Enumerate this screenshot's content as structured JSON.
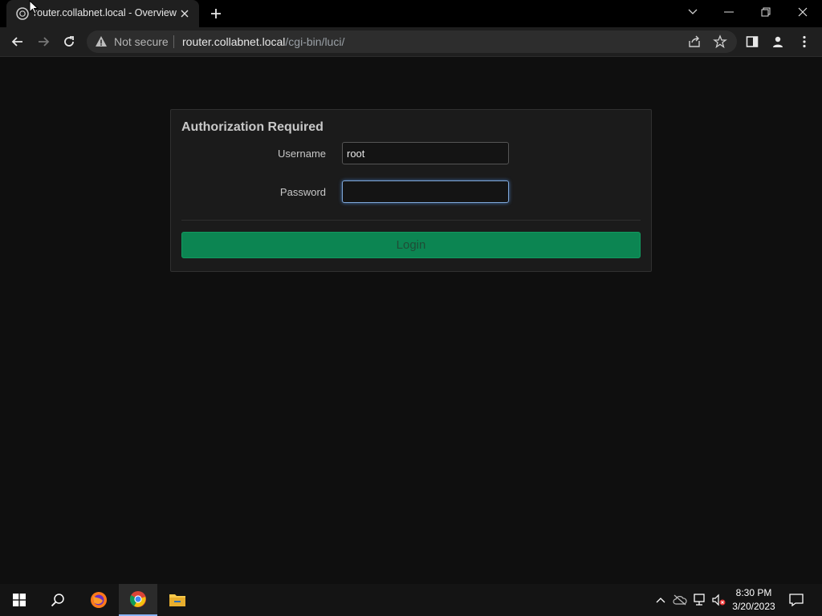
{
  "browser": {
    "tab": {
      "title": "router.collabnet.local - Overview",
      "favicon": "openwrt-icon"
    },
    "new_tab_icon": "plus-icon",
    "window_controls": [
      "chevron-down-icon",
      "minimize-icon",
      "restore-icon",
      "close-icon"
    ],
    "toolbar": {
      "security_label": "Not secure",
      "url_host": "router.collabnet.local",
      "url_path": "/cgi-bin/luci/"
    }
  },
  "login": {
    "title": "Authorization Required",
    "username_label": "Username",
    "username_value": "root",
    "password_label": "Password",
    "password_value": "",
    "login_button": "Login"
  },
  "taskbar": {
    "apps": [
      "windows-start-icon",
      "search-icon",
      "firefox-icon",
      "chrome-icon",
      "file-explorer-icon"
    ],
    "active_app": "chrome-icon",
    "clock_time": "8:30 PM",
    "clock_date": "3/20/2023"
  },
  "colors": {
    "login_button": "#0c8552",
    "page_background": "#0f0f0f",
    "focus_ring": "#7fa7d8"
  }
}
